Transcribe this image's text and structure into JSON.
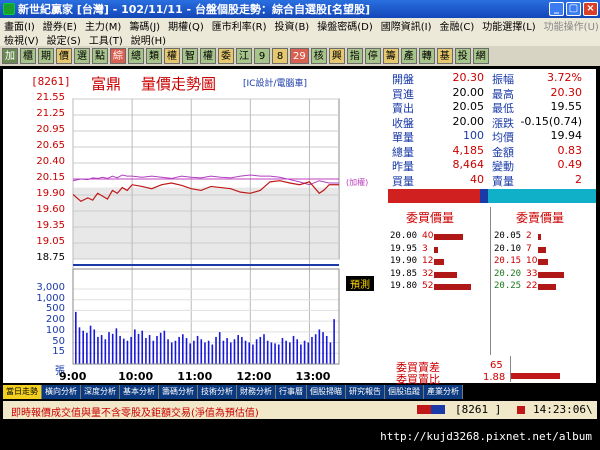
{
  "window": {
    "title": "新世紀贏家 [台灣] - 102/11/11 - 台盤個股走勢：綜合自選股[名望股]",
    "min": "_",
    "max": "▢",
    "close": "×"
  },
  "menu": {
    "row1": [
      "畫面(I)",
      "證券(E)",
      "主力(M)",
      "籌碼(J)",
      "期權(Q)",
      "匯市利率(R)",
      "投資(B)",
      "操盤密碼(D)",
      "國際資訊(I)",
      "金融(C)",
      "功能選擇(L)"
    ],
    "row1_dim": "功能操作(U)",
    "row2": [
      "檢視(V)",
      "設定(S)",
      "工具(T)",
      "說明(H)"
    ]
  },
  "toolbar": {
    "buttons": [
      "加",
      "櫃",
      "期",
      "價",
      "選",
      "點",
      "綜",
      "總",
      "類",
      "權",
      "智",
      "權",
      "委",
      "江",
      "9",
      "8",
      "29",
      "核",
      "興",
      "指",
      "停",
      "籌",
      "產",
      "轉",
      "基",
      "投",
      "網"
    ]
  },
  "stock": {
    "code": "[8261]",
    "name": "富鼎",
    "chart_title": "量價走勢圖",
    "industry": "[IC設計/電腦車]"
  },
  "chart": {
    "ref_note": "(加權)",
    "prediction_label": "預測",
    "volume_unit": "張"
  },
  "chart_data": {
    "type": "line",
    "price": {
      "ticks": [
        "21.55",
        "21.25",
        "20.95",
        "20.65",
        "20.40",
        "20.15",
        "19.90",
        "19.60",
        "19.35",
        "19.05",
        "18.75"
      ],
      "ref": 20.0,
      "ylim": [
        18.75,
        21.55
      ],
      "xlim": [
        0,
        270
      ],
      "x": [
        0,
        8,
        15,
        20,
        25,
        30,
        35,
        40,
        45,
        50,
        55,
        60,
        70,
        80,
        90,
        100,
        110,
        120,
        130,
        140,
        150,
        160,
        170,
        180,
        190,
        200,
        210,
        220,
        230,
        240,
        250,
        255,
        260,
        270
      ],
      "y": [
        19.88,
        19.76,
        19.82,
        19.78,
        19.9,
        19.85,
        19.8,
        19.95,
        19.9,
        20.0,
        19.95,
        20.05,
        20.02,
        19.98,
        20.05,
        20.08,
        20.04,
        19.98,
        19.95,
        20.02,
        20.0,
        19.98,
        19.92,
        19.9,
        19.95,
        20.1,
        20.12,
        20.08,
        20.05,
        20.1,
        19.9,
        19.96,
        20.05,
        20.05
      ],
      "index_line": [
        20.12,
        20.15,
        20.14,
        20.17,
        20.16,
        20.18,
        20.16,
        20.2,
        20.17,
        20.22,
        20.2,
        20.2,
        20.18,
        20.2,
        20.18,
        20.16,
        20.2,
        20.18,
        20.17,
        20.2,
        20.18,
        20.17,
        20.2,
        20.22,
        20.2,
        20.2,
        20.18,
        20.14,
        20.1,
        20.05,
        20.12,
        20.1,
        20.08,
        20.08
      ]
    },
    "volume": {
      "ticks": [
        "3,000",
        "1,000",
        "500",
        "200",
        "100",
        "50",
        "15"
      ],
      "values": [
        260,
        50,
        35,
        28,
        60,
        40,
        18,
        22,
        14,
        30,
        25,
        45,
        20,
        15,
        12,
        18,
        40,
        25,
        35,
        16,
        22,
        12,
        20,
        28,
        35,
        14,
        10,
        12,
        18,
        24,
        16,
        9,
        12,
        20,
        14,
        10,
        12,
        8,
        18,
        30,
        12,
        16,
        10,
        14,
        22,
        18,
        12,
        10,
        8,
        14,
        18,
        24,
        12,
        10,
        9,
        8,
        16,
        12,
        10,
        20,
        14,
        8,
        12,
        10,
        18,
        24,
        40,
        30,
        20,
        10,
        120
      ]
    },
    "x_ticks": [
      "9:00",
      "10:00",
      "11:00",
      "12:00",
      "13:00"
    ]
  },
  "quote": {
    "rows": [
      {
        "l1": "開盤",
        "v1": "20.30",
        "l2": "振幅",
        "v2": "3.72%",
        "c1": "#c00",
        "c2": "#c00"
      },
      {
        "l1": "買進",
        "v1": "20.00",
        "l2": "最高",
        "v2": "20.30",
        "c1": "#000",
        "c2": "#c00"
      },
      {
        "l1": "賣出",
        "v1": "20.05",
        "l2": "最低",
        "v2": "19.55",
        "c1": "#000",
        "c2": "#000"
      },
      {
        "l1": "收盤",
        "v1": "20.00",
        "l2": "漲跌",
        "v2": "-0.15(0.74)",
        "c1": "#000",
        "c2": "#000"
      },
      {
        "l1": "單量",
        "v1": "100",
        "l2": "均價",
        "v2": "19.94",
        "c1": "#1a3aa8",
        "c2": "#000"
      },
      {
        "l1": "總量",
        "v1": "4,185",
        "l2": "金額",
        "v2": "0.83",
        "c1": "#c00",
        "c2": "#c00"
      },
      {
        "l1": "昨量",
        "v1": "8,464",
        "l2": "變動",
        "v2": "0.49",
        "c1": "#c00",
        "c2": "#c00"
      },
      {
        "l1": "買量",
        "v1": "40",
        "l2": "賣量",
        "v2": "2",
        "c1": "#c00",
        "c2": "#c00"
      }
    ]
  },
  "orderbook": {
    "bid_header": "委買價量",
    "ask_header": "委賣價量",
    "bids": [
      {
        "price": "20.00",
        "qty": "40",
        "fill": 0.55
      },
      {
        "price": "19.95",
        "qty": "3",
        "fill": 0.08
      },
      {
        "price": "19.90",
        "qty": "12",
        "fill": 0.2
      },
      {
        "price": "19.85",
        "qty": "32",
        "fill": 0.45
      },
      {
        "price": "19.80",
        "qty": "52",
        "fill": 0.72
      }
    ],
    "asks": [
      {
        "price": "20.05",
        "qty": "2",
        "fill": 0.05,
        "pc": "#000"
      },
      {
        "price": "20.10",
        "qty": "7",
        "fill": 0.15,
        "pc": "#000"
      },
      {
        "price": "20.15",
        "qty": "10",
        "fill": 0.2,
        "pc": "#c00"
      },
      {
        "price": "20.20",
        "qty": "33",
        "fill": 0.5,
        "pc": "#1a7a1a"
      },
      {
        "price": "20.25",
        "qty": "22",
        "fill": 0.35,
        "pc": "#1a7a1a"
      }
    ],
    "diff_label": "委買賣差",
    "diff_value": "65",
    "ratio_label": "委買賣比",
    "ratio_value": "1.88"
  },
  "tabs": [
    "當日走勢",
    "橫向分析",
    "深度分析",
    "基本分析",
    "籌碼分析",
    "技術分析",
    "財務分析",
    "行事曆",
    "個股掃瞄",
    "研究報告",
    "個股追蹤",
    "產業分析"
  ],
  "status": {
    "message": "即時報價成交值與量不含零股及鉅額交易(淨值為預估值)",
    "code": "[8261 ]",
    "time": "14:23:06\\"
  },
  "watermark": "http://kujd3268.pixnet.net/album"
}
